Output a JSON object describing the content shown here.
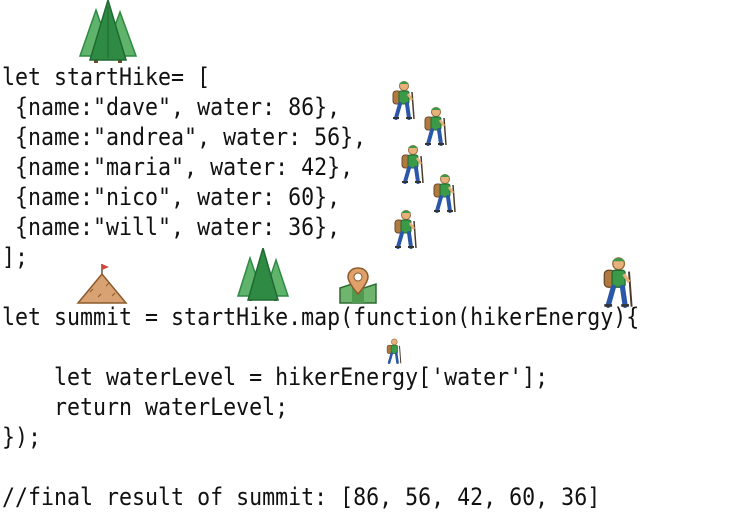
{
  "code_lines": [
    "let startHike= [",
    " {name:\"dave\", water: 86},",
    " {name:\"andrea\", water: 56},",
    " {name:\"maria\", water: 42},",
    " {name:\"nico\", water: 60},",
    " {name:\"will\", water: 36},",
    "];",
    "",
    "let summit = startHike.map(function(hikerEnergy){",
    "",
    "    let waterLevel = hikerEnergy['water'];",
    "    return waterLevel;",
    "});",
    "",
    "//final result of summit: [86, 56, 42, 60, 36]"
  ],
  "icons": {
    "trees": "evergreen-trees-icon",
    "hiker": "hiker-icon",
    "mountain": "mountain-summit-icon",
    "map": "map-pin-icon"
  },
  "colors": {
    "text": "#111111",
    "tree_light": "#5fb36a",
    "tree_dark": "#2f8a44",
    "hiker_shirt": "#3a9a48",
    "hiker_pants": "#2b57a8",
    "hiker_skin": "#e8b17c",
    "mountain": "#d9a273",
    "flag": "#c94a3a"
  }
}
